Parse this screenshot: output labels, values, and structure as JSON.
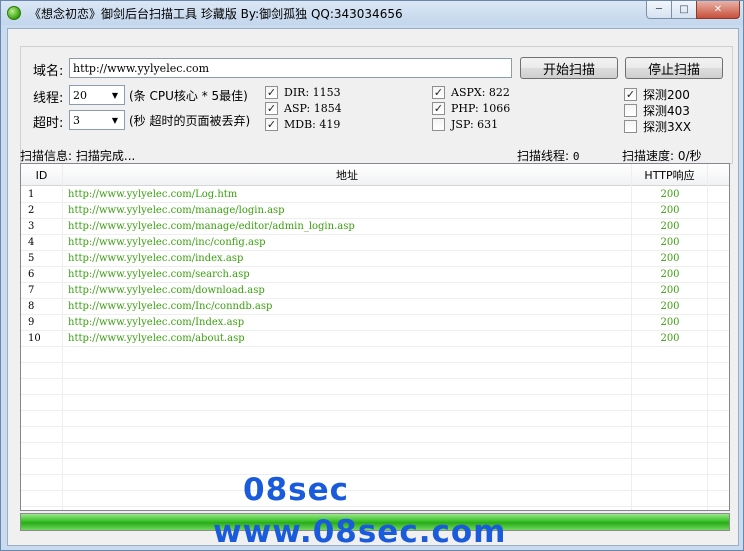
{
  "window": {
    "title": "《想念初恋》御剑后台扫描工具 珍藏版 By:御剑孤独 QQ:343034656",
    "minimize": "─",
    "maximize": "□",
    "close": "✕"
  },
  "form": {
    "domain_label": "域名:",
    "domain_value": "http://www.yylyelec.com",
    "threads_label": "线程:",
    "threads_value": "20",
    "threads_hint": "(条 CPU核心 * 5最佳)",
    "timeout_label": "超时:",
    "timeout_value": "3",
    "timeout_hint": "(秒 超时的页面被丢弃)",
    "start_button": "开始扫描",
    "stop_button": "停止扫描"
  },
  "dictionaries": [
    {
      "label": "DIR: 1153",
      "checked": true
    },
    {
      "label": "ASP: 1854",
      "checked": true
    },
    {
      "label": "MDB: 419",
      "checked": true
    },
    {
      "label": "ASPX: 822",
      "checked": true
    },
    {
      "label": "PHP: 1066",
      "checked": true
    },
    {
      "label": "JSP: 631",
      "checked": false
    }
  ],
  "probes": [
    {
      "label": "探测200",
      "checked": true
    },
    {
      "label": "探测403",
      "checked": false
    },
    {
      "label": "探测3XX",
      "checked": false
    }
  ],
  "status": {
    "info_label": "扫描信息:",
    "info_value": "扫描完成...",
    "threads_label": "扫描线程:",
    "threads_value": "0",
    "speed_label": "扫描速度:",
    "speed_value": "0/秒"
  },
  "table": {
    "columns": [
      "ID",
      "地址",
      "HTTP响应"
    ],
    "rows": [
      {
        "id": "1",
        "url": "http://www.yylyelec.com/Log.htm",
        "code": "200"
      },
      {
        "id": "2",
        "url": "http://www.yylyelec.com/manage/login.asp",
        "code": "200"
      },
      {
        "id": "3",
        "url": "http://www.yylyelec.com/manage/editor/admin_login.asp",
        "code": "200"
      },
      {
        "id": "4",
        "url": "http://www.yylyelec.com/inc/config.asp",
        "code": "200"
      },
      {
        "id": "5",
        "url": "http://www.yylyelec.com/index.asp",
        "code": "200"
      },
      {
        "id": "6",
        "url": "http://www.yylyelec.com/search.asp",
        "code": "200"
      },
      {
        "id": "7",
        "url": "http://www.yylyelec.com/download.asp",
        "code": "200"
      },
      {
        "id": "8",
        "url": "http://www.yylyelec.com/Inc/conndb.asp",
        "code": "200"
      },
      {
        "id": "9",
        "url": "http://www.yylyelec.com/Index.asp",
        "code": "200"
      },
      {
        "id": "10",
        "url": "http://www.yylyelec.com/about.asp",
        "code": "200"
      }
    ],
    "row_color": "#3aa00e"
  },
  "progress": {
    "value": 1.0,
    "color": "#2aab19"
  },
  "watermark": {
    "line1": "08sec",
    "line2": "www.08sec.com",
    "color": "#1a5bdc"
  }
}
